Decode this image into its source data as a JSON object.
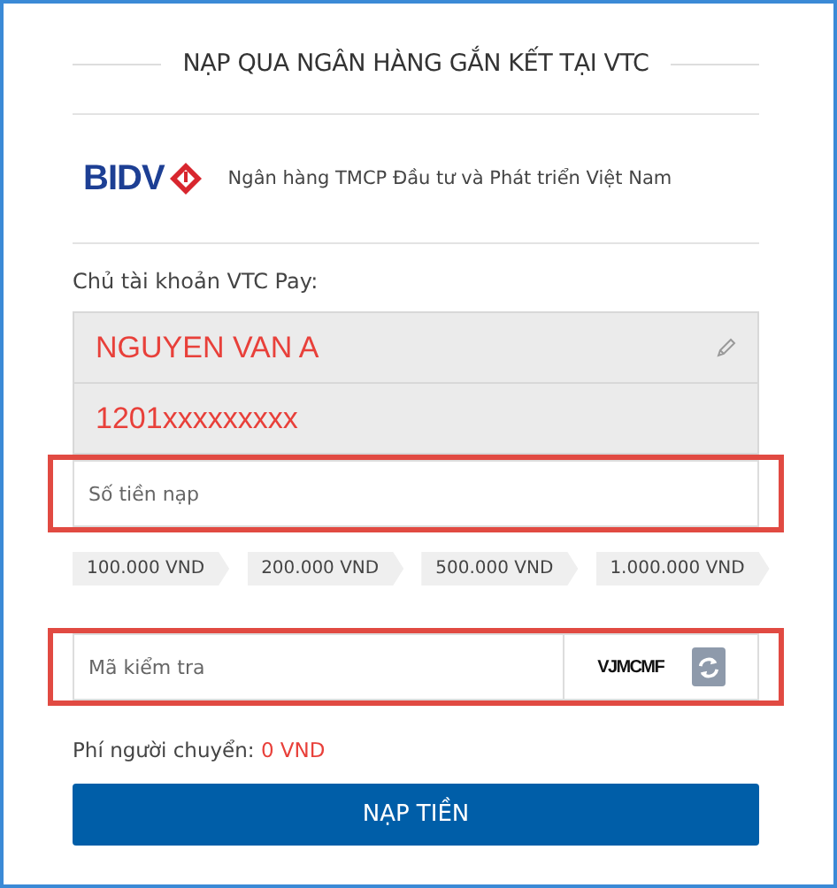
{
  "title": "NẠP QUA NGÂN HÀNG GẮN KẾT TẠI VTC",
  "bank": {
    "logo_text": "BIDV",
    "name": "Ngân hàng TMCP Đầu tư và Phát triển Việt Nam"
  },
  "owner_label": "Chủ tài khoản VTC Pay:",
  "account": {
    "name": "NGUYEN VAN A",
    "number": "1201xxxxxxxxx"
  },
  "amount": {
    "placeholder": "Số tiền nạp",
    "highlighted": true
  },
  "presets": [
    "100.000 VND",
    "200.000 VND",
    "500.000 VND",
    "1.000.000 VND"
  ],
  "captcha": {
    "placeholder": "Mã kiểm tra",
    "code": "VJMCMF",
    "highlighted": true
  },
  "fee": {
    "label": "Phí người chuyển:",
    "value": "0 VND"
  },
  "submit": "NẠP TIỀN"
}
